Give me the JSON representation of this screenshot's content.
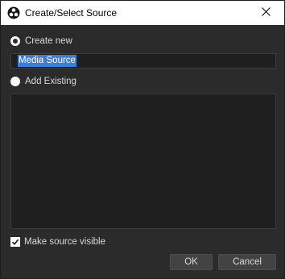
{
  "window": {
    "title": "Create/Select Source",
    "app_icon": "obs-icon",
    "close_icon": "close-icon"
  },
  "create_new": {
    "label": "Create new",
    "selected": true
  },
  "name_input": {
    "value": "Media Source"
  },
  "add_existing": {
    "label": "Add Existing",
    "selected": false
  },
  "existing_list": {
    "items": []
  },
  "visibility": {
    "label": "Make source visible",
    "checked": true
  },
  "buttons": {
    "ok": "OK",
    "cancel": "Cancel"
  },
  "colors": {
    "background": "#2b2b2b",
    "field_background": "#1f1f1f",
    "selection": "#3d7ed3",
    "button": "#434343",
    "text": "#d9d9d9"
  }
}
